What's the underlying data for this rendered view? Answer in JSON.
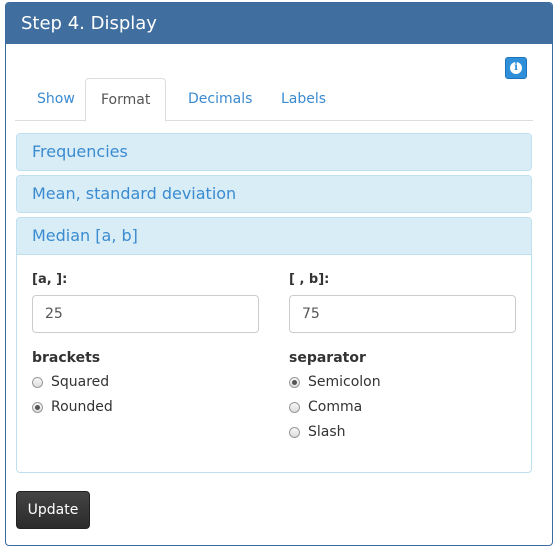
{
  "panel": {
    "title": "Step 4. Display"
  },
  "info_icon": {
    "glyph": "i"
  },
  "tabs": [
    {
      "label": "Show"
    },
    {
      "label": "Format"
    },
    {
      "label": "Decimals"
    },
    {
      "label": "Labels"
    }
  ],
  "active_tab": "Format",
  "accordion": {
    "frequencies": "Frequencies",
    "mean_sd": "Mean, standard deviation",
    "median": "Median [a, b]"
  },
  "median": {
    "a_label": "[a, ]:",
    "a_value": "25",
    "b_label": "[ , b]:",
    "b_value": "75",
    "brackets_label": "brackets",
    "brackets_options": [
      "Squared",
      "Rounded"
    ],
    "brackets_selected": "Rounded",
    "separator_label": "separator",
    "separator_options": [
      "Semicolon",
      "Comma",
      "Slash"
    ],
    "separator_selected": "Semicolon"
  },
  "update_button": "Update"
}
